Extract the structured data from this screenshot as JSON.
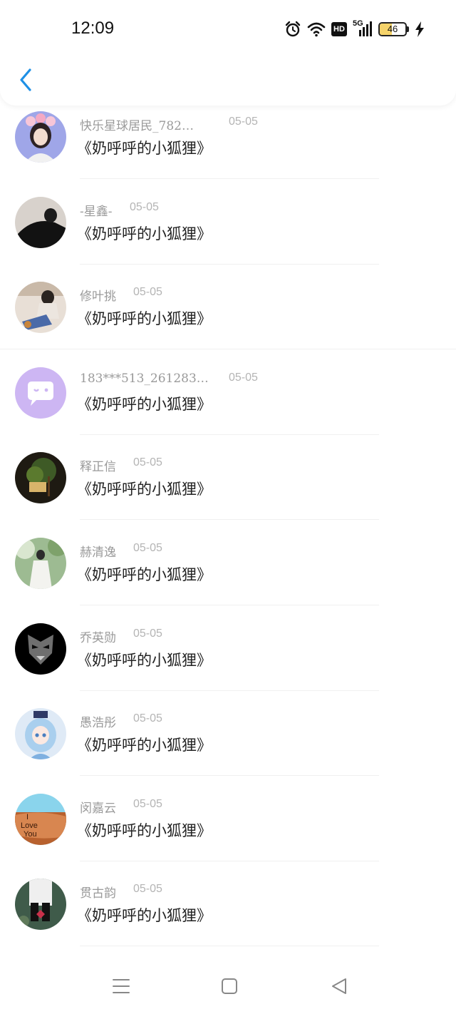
{
  "status_bar": {
    "time": "12:09",
    "network_label": "5G",
    "hd_label": "HD",
    "battery": "46",
    "battery_level": 0.46,
    "icons": [
      "alarm-icon",
      "wifi-icon",
      "hd-icon",
      "signal-icon",
      "battery-icon",
      "charging-icon"
    ]
  },
  "header": {
    "back_icon": "chevron-left-icon",
    "accent": "#1e90e6"
  },
  "items": [
    {
      "name": "快乐星球居民_782…",
      "date": "05-05",
      "title": "《奶呼呼的小狐狸》",
      "avatar": "avatar-girl-flowers"
    },
    {
      "name": "-星鑫-",
      "date": "05-05",
      "title": "《奶呼呼的小狐狸》",
      "avatar": "avatar-dark-figure"
    },
    {
      "name": "修叶挑",
      "date": "05-05",
      "title": "《奶呼呼的小狐狸》",
      "avatar": "avatar-girl-sitting"
    },
    {
      "name": "183***513_261283…",
      "date": "05-05",
      "title": "《奶呼呼的小狐狸》",
      "avatar": "avatar-default-chat"
    },
    {
      "name": "释正信",
      "date": "05-05",
      "title": "《奶呼呼的小狐狸》",
      "avatar": "avatar-tree-house"
    },
    {
      "name": "赫清逸",
      "date": "05-05",
      "title": "《奶呼呼的小狐狸》",
      "avatar": "avatar-person-forest"
    },
    {
      "name": "乔英勋",
      "date": "05-05",
      "title": "《奶呼呼的小狐狸》",
      "avatar": "avatar-mask"
    },
    {
      "name": "愚浩彤",
      "date": "05-05",
      "title": "《奶呼呼的小狐狸》",
      "avatar": "avatar-anime-girl"
    },
    {
      "name": "闵嘉云",
      "date": "05-05",
      "title": "《奶呼呼的小狐狸》",
      "avatar": "avatar-i-love-you"
    },
    {
      "name": "贯古韵",
      "date": "05-05",
      "title": "《奶呼呼的小狐狸》",
      "avatar": "avatar-butterfly-boots"
    }
  ],
  "nav_bar": {
    "icons": [
      "menu-icon",
      "home-square-icon",
      "back-triangle-icon"
    ]
  }
}
